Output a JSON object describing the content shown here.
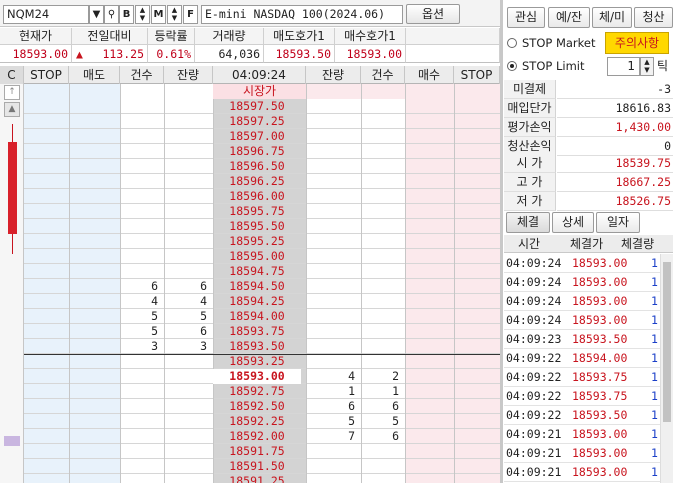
{
  "toolbar": {
    "symbol": "NQM24",
    "product_name": "E-mini NASDAQ 100(2024.06)",
    "buttons": [
      "B",
      "M",
      "F"
    ],
    "options_label": "옵션"
  },
  "quote": {
    "headers": [
      "현재가",
      "전일대비",
      "등락률",
      "거래량",
      "매도호가1",
      "매수호가1"
    ],
    "current_price": "18593.00",
    "change": "113.25",
    "change_rate": "0.61%",
    "volume": "64,036",
    "ask1": "18593.50",
    "bid1": "18593.00",
    "up_arrow": "▲"
  },
  "ladder": {
    "headers": [
      "C",
      "STOP",
      "매도",
      "건수",
      "잔량",
      "04:09:24",
      "잔량",
      "건수",
      "매수",
      "STOP"
    ],
    "market_open_label": "시장가",
    "current_price": "18593.00",
    "prices": [
      "18597.50",
      "18597.25",
      "18597.00",
      "18596.75",
      "18596.50",
      "18596.25",
      "18596.00",
      "18595.75",
      "18595.50",
      "18595.25",
      "18595.00",
      "18594.75",
      "18594.50",
      "18594.25",
      "18594.00",
      "18593.75",
      "18593.50",
      "18593.25",
      "18593.00",
      "18592.75",
      "18592.50",
      "18592.25",
      "18592.00",
      "18591.75",
      "18591.50",
      "18591.25"
    ],
    "ask_counts": {
      "12": "6",
      "13": "4",
      "14": "5",
      "15": "5",
      "16": "3"
    },
    "ask_sizes": {
      "12": "6",
      "13": "4",
      "14": "5",
      "15": "6",
      "16": "3"
    },
    "bid_sizes": {
      "18": "4",
      "19": "1",
      "20": "6",
      "21": "5",
      "22": "7"
    },
    "bid_counts": {
      "18": "2",
      "19": "1",
      "20": "6",
      "21": "5",
      "22": "6"
    }
  },
  "right_panel": {
    "tabs": [
      "관심",
      "예/잔",
      "체/미",
      "청산"
    ],
    "stop_market_label": "STOP Market",
    "caution_label": "주의사항",
    "stop_limit_label": "STOP Limit",
    "tick_value": "1",
    "tick_label": "틱",
    "stats": [
      {
        "label": "미결제",
        "value": "-3",
        "color": "#222222"
      },
      {
        "label": "매입단가",
        "value": "18616.83",
        "color": "#222222"
      },
      {
        "label": "평가손익",
        "value": "1,430.00",
        "color": "#c8141e"
      },
      {
        "label": "청산손익",
        "value": "0",
        "color": "#222222"
      }
    ],
    "ohlc": [
      {
        "label": "시 가",
        "value": "18539.75"
      },
      {
        "label": "고 가",
        "value": "18667.25"
      },
      {
        "label": "저 가",
        "value": "18526.75"
      }
    ],
    "trade_tabs": [
      "체결",
      "상세",
      "일자"
    ],
    "trade_headers": [
      "시간",
      "체결가",
      "체결량"
    ],
    "trades": [
      {
        "time": "04:09:24",
        "price": "18593.00",
        "qty": "1"
      },
      {
        "time": "04:09:24",
        "price": "18593.00",
        "qty": "1"
      },
      {
        "time": "04:09:24",
        "price": "18593.00",
        "qty": "1"
      },
      {
        "time": "04:09:24",
        "price": "18593.00",
        "qty": "1"
      },
      {
        "time": "04:09:23",
        "price": "18593.50",
        "qty": "1"
      },
      {
        "time": "04:09:22",
        "price": "18594.00",
        "qty": "1"
      },
      {
        "time": "04:09:22",
        "price": "18593.75",
        "qty": "1"
      },
      {
        "time": "04:09:22",
        "price": "18593.75",
        "qty": "1"
      },
      {
        "time": "04:09:22",
        "price": "18593.50",
        "qty": "1"
      },
      {
        "time": "04:09:21",
        "price": "18593.00",
        "qty": "1"
      },
      {
        "time": "04:09:21",
        "price": "18593.00",
        "qty": "1"
      },
      {
        "time": "04:09:21",
        "price": "18593.00",
        "qty": "1"
      }
    ]
  },
  "colors": {
    "price_red": "#c8141e",
    "qty_blue": "#1a3fc8",
    "ask_bg": "#e8f2fb",
    "bid_bg": "#fbe9ec",
    "price_col_bg": "#d3d3d3",
    "caution_bg": "#ffd800"
  }
}
